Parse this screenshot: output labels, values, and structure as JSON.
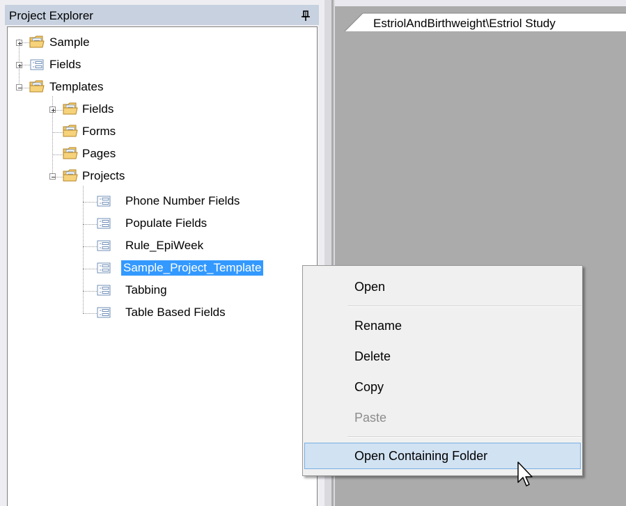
{
  "explorer": {
    "title": "Project Explorer",
    "tree": [
      {
        "label": "Sample",
        "icon": "folder-icon",
        "expander": "plus"
      },
      {
        "label": "Fields",
        "icon": "fields-icon",
        "expander": "plus"
      },
      {
        "label": "Templates",
        "icon": "folder-icon",
        "expander": "minus"
      },
      {
        "label": "Fields",
        "icon": "folder-icon",
        "expander": "plus"
      },
      {
        "label": "Forms",
        "icon": "folder-icon",
        "expander": "none"
      },
      {
        "label": "Pages",
        "icon": "folder-icon",
        "expander": "none"
      },
      {
        "label": "Projects",
        "icon": "folder-icon",
        "expander": "minus"
      },
      {
        "label": "Phone Number Fields",
        "icon": "fields-icon"
      },
      {
        "label": "Populate Fields",
        "icon": "fields-icon"
      },
      {
        "label": "Rule_EpiWeek",
        "icon": "fields-icon"
      },
      {
        "label": "Sample_Project_Template",
        "icon": "fields-icon",
        "selected": true
      },
      {
        "label": "Tabbing",
        "icon": "fields-icon"
      },
      {
        "label": "Table Based Fields",
        "icon": "fields-icon"
      }
    ]
  },
  "document": {
    "tab_label": "EstriolAndBirthweight\\Estriol Study"
  },
  "context_menu": {
    "items": [
      {
        "label": "Open",
        "state": "normal"
      },
      {
        "label": "Rename",
        "state": "normal"
      },
      {
        "label": "Delete",
        "state": "normal"
      },
      {
        "label": "Copy",
        "state": "normal"
      },
      {
        "label": "Paste",
        "state": "disabled"
      },
      {
        "label": "Open Containing Folder",
        "state": "hover"
      }
    ]
  },
  "colors": {
    "selection": "#3399ff",
    "menu_hover": "#d1e2f2",
    "header": "#c7d1df"
  }
}
